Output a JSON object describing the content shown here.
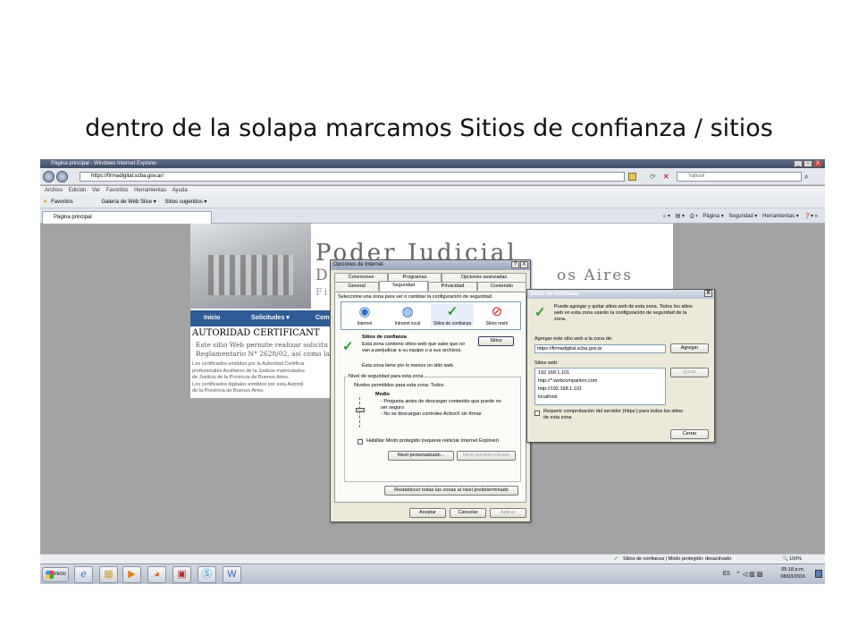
{
  "slide": {
    "caption": "dentro de la solapa marcamos Sitios de confianza / sitios"
  },
  "browser": {
    "window_title": "Página principal - Windows Internet Explorer",
    "window_buttons": [
      "_",
      "▫",
      "X"
    ],
    "address": "https://firmadigital.scba.gov.ar/",
    "search_placeholder": "Yahoo!",
    "menu": [
      "Archivo",
      "Edición",
      "Ver",
      "Favoritos",
      "Herramientas",
      "Ayuda"
    ],
    "favorites_label": "Favoritos",
    "fav_links": [
      "Galería de Web Slice ▾",
      "Sitios sugeridos ▾"
    ],
    "tab_title": "Página principal",
    "command_bar": [
      "Página ▾",
      "Seguridad ▾",
      "Herramientas ▾"
    ]
  },
  "webpage": {
    "header_line1": "Poder Judicial",
    "header_line2": "de la Provincia de Buenos Aires",
    "header_line2_visible": "D",
    "header_line2_right": "os Aires",
    "header_line3": "Firma",
    "header_line3_visible": "Fir",
    "nav": [
      "Inicio",
      "Solicitudes ▾",
      "Com"
    ],
    "heading": "AUTORIDAD CERTIFICANT",
    "paragraph_visible": "Este sitio Web permite realizar solicitu Reglamentario N° 2628/02, así como la",
    "small_text": [
      "Los certificados emitidos por la Autoridad Certificar",
      "profesionales Auxiliares de la Justicia matriculados",
      "de Justicia de la Provincia de Buenos Aires.",
      "Los certificados digitales emitidos por esta Autorid",
      "de la Provincia de Buenos Aires."
    ]
  },
  "internet_options": {
    "title": "Opciones de Internet",
    "help": "?",
    "close": "X",
    "tabs_row1": [
      "Conexiones",
      "Programas",
      "Opciones avanzadas"
    ],
    "tabs_row2": [
      "General",
      "Seguridad",
      "Privacidad",
      "Contenido"
    ],
    "active_tab": "Seguridad",
    "zone_prompt": "Seleccione una zona para ver o cambiar la configuración de seguridad.",
    "zones": [
      {
        "label": "Internet",
        "icon": "globe-icon"
      },
      {
        "label": "Intranet local",
        "icon": "intranet-icon"
      },
      {
        "label": "Sitios de confianza",
        "icon": "check-icon"
      },
      {
        "label": "Sitios restri",
        "icon": "restricted-icon"
      }
    ],
    "selected_zone": "Sitios de confianza",
    "zone_title": "Sitios de confianza",
    "zone_desc": [
      "Esta zona contiene sitios web que sabe que no",
      "van a perjudicar a su equipo o a sus archivos."
    ],
    "zone_note": "Esta zona tiene por lo menos un sitio web.",
    "sites_button": "Sitios",
    "group_title": "Nivel de seguridad para esta zona",
    "allowed_levels": "Niveles permitidos para esta zona: Todos",
    "level_name": "Medio",
    "level_desc": [
      "- Pregunta antes de descargar contenido que puede no",
      "  ser seguro",
      "- No se descargan controles ActiveX sin firmar"
    ],
    "protected_mode": "Habilitar Modo protegido (requiere reiniciar Internet Explorer)",
    "custom_level": "Nivel personalizado...",
    "default_level": "Nivel predeterminado",
    "reset_all": "Restablecer todas las zonas al nivel predeterminado",
    "ok": "Aceptar",
    "cancel": "Cancelar",
    "apply": "Aplicar"
  },
  "trusted_sites": {
    "title": "Sitios de confianza",
    "close": "X",
    "info": [
      "Puede agregar y quitar sitios web de esta zona. Todos los sitios",
      "web en esta zona usarán la configuración de seguridad de la",
      "zona."
    ],
    "add_label": "Agregar este sitio web a la zona de:",
    "add_value": "https://firmadigital.scba.gov.ar",
    "add_button": "Agregar",
    "sites_label": "Sitios web:",
    "sites": [
      "192.168.1.101",
      "http://*.webcompanion.com",
      "http://192.168.1.101",
      "localhost"
    ],
    "remove_button": "Quitar",
    "require_https": [
      "Requerir comprobación del servidor (https:) para todos los sitios",
      "de esta zona"
    ],
    "close_button": "Cerrar"
  },
  "status": {
    "zone_text": "Sitios de confianza | Modo protegido: desactivado",
    "zoom": "100%"
  },
  "taskbar": {
    "start": "Inicio",
    "lang": "ES",
    "time": "05:18 p.m.",
    "date": "08/03/2016"
  }
}
